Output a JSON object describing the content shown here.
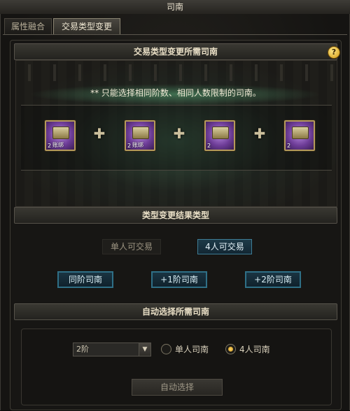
{
  "window": {
    "title": "司南"
  },
  "tabs": [
    {
      "label": "属性融合"
    },
    {
      "label": "交易类型变更"
    }
  ],
  "sections": {
    "required": {
      "title": "交易类型变更所需司南",
      "help_label": "?"
    },
    "result": {
      "title": "类型变更结果类型"
    },
    "auto": {
      "title": "自动选择所需司南"
    }
  },
  "notice": "** 只能选择相同阶数、相同人数限制的司南。",
  "slots": [
    {
      "level": "2",
      "tag": "账绑"
    },
    {
      "level": "2",
      "tag": "账绑"
    },
    {
      "level": "2",
      "tag": ""
    },
    {
      "level": "2",
      "tag": ""
    }
  ],
  "plus_symbol": "✚",
  "trade_types": [
    {
      "label": "单人可交易",
      "selected": false
    },
    {
      "label": "4人可交易",
      "selected": true
    }
  ],
  "tier_buttons": [
    {
      "label": "同阶司南"
    },
    {
      "label": "+1阶司南"
    },
    {
      "label": "+2阶司南"
    }
  ],
  "auto_select": {
    "tier_value": "2阶",
    "radio_options": [
      {
        "label": "单人司南",
        "checked": false
      },
      {
        "label": "4人司南",
        "checked": true
      }
    ],
    "button_label": "自动选择"
  },
  "icons": {
    "help": "help-icon",
    "dropdown": "chevron-down-icon",
    "plus": "plus-icon"
  },
  "colors": {
    "accent_blue": "#2f6f86",
    "radio_gold": "#ffd76a",
    "slot_purple": "#6e3d98"
  }
}
